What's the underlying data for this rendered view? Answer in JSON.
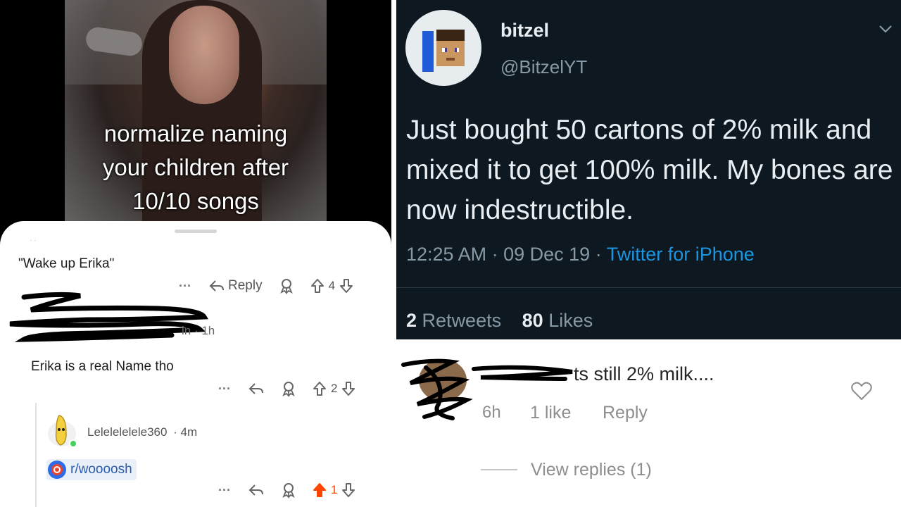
{
  "left_panel": {
    "video_caption": [
      "normalize naming",
      "your children after",
      "10/10 songs"
    ],
    "top_comment": {
      "text": "\"Wake up Erika\"",
      "more": "···",
      "reply_label": "Reply",
      "votes": "4"
    },
    "comment_2": {
      "meta": "in · 1h",
      "text": "Erika is a real Name tho",
      "more": "···",
      "votes": "2"
    },
    "comment_3": {
      "username": "Lelelelelele360",
      "time": "· 4m",
      "subreddit_link": "r/woooosh",
      "more": "···",
      "votes": "1"
    },
    "colors": {
      "upvote_active": "#ff4500",
      "link": "#2a5db0"
    }
  },
  "right_panel": {
    "tweet": {
      "display_name": "bitzel",
      "handle": "@BitzelYT",
      "text": "Just bought 50 cartons of 2% milk and mixed it to get 100% milk. My bones are now indestructible.",
      "time": "12:25 AM",
      "date": "09 Dec 19",
      "source": "Twitter for iPhone",
      "retweets_count": "2",
      "retweets_label": "Retweets",
      "likes_count": "80",
      "likes_label": "Likes"
    },
    "instagram_comment": {
      "text": "ts still 2% milk....",
      "time": "6h",
      "likes": "1 like",
      "reply_label": "Reply",
      "view_replies": "View replies (1)"
    },
    "colors": {
      "tweet_bg": "#0d1821",
      "twitter_blue": "#1b95e0"
    }
  }
}
